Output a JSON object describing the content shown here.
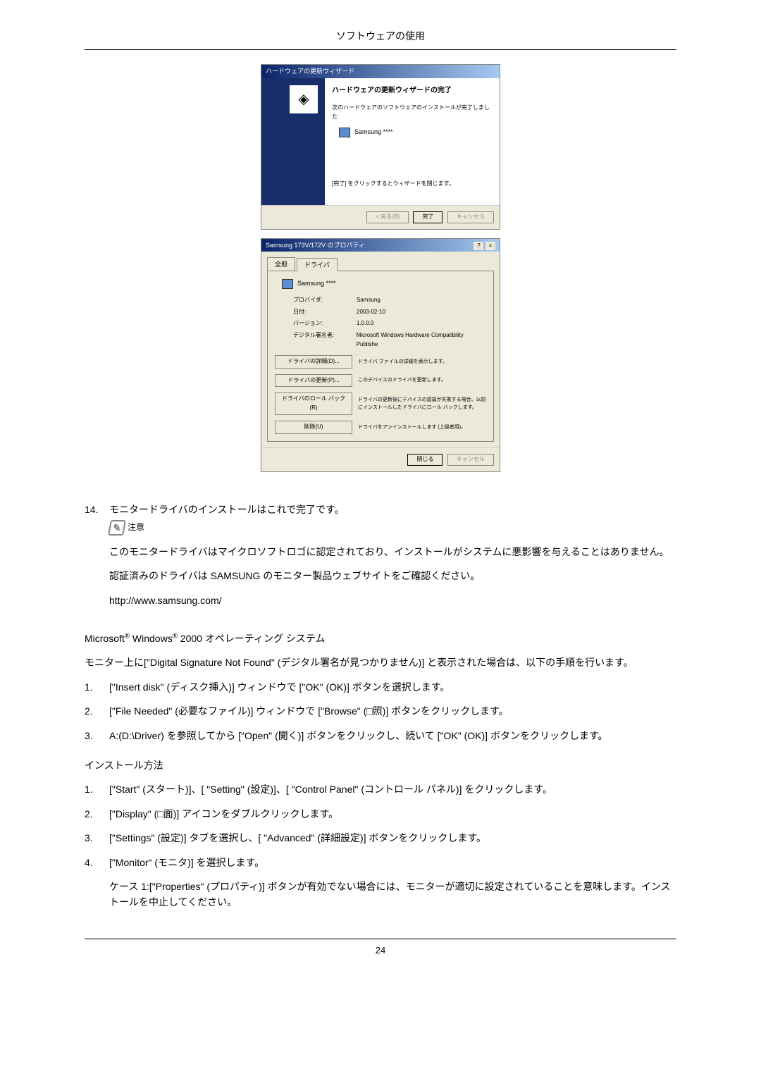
{
  "header": {
    "title": "ソフトウェアの使用"
  },
  "wizard": {
    "titlebar": "ハードウェアの更新ウィザード",
    "heading": "ハードウェアの更新ウィザードの完了",
    "subtitle": "次のハードウェアのソフトウェアのインストールが完了しました",
    "device": "Samsung ****",
    "footer_text": "[完了] をクリックするとウィザードを閉じます。",
    "btn_back": "< 戻る(B)",
    "btn_finish": "完了",
    "btn_cancel": "キャンセル"
  },
  "props": {
    "titlebar": "Samsung 173V/172V のプロパティ",
    "close_help": "?",
    "close_x": "×",
    "tab_general": "全般",
    "tab_driver": "ドライバ",
    "device_name": "Samsung ****",
    "rows": {
      "provider_label": "プロバイダ:",
      "provider_value": "Samsung",
      "date_label": "日付:",
      "date_value": "2003-02-10",
      "version_label": "バージョン:",
      "version_value": "1.0.0.0",
      "signer_label": "デジタル署名者:",
      "signer_value": "Microsoft Windows Hardware Compatibility Publishe"
    },
    "buttons": {
      "details": "ドライバの詳細(D)...",
      "details_desc": "ドライバ ファイルの詳細を表示します。",
      "update": "ドライバの更新(P)...",
      "update_desc": "このデバイスのドライバを更新します。",
      "rollback": "ドライバのロール バック(R)",
      "rollback_desc": "ドライバの更新後にデバイスの認識が失敗する場合、以前にインストールしたドライバにロール バックします。",
      "uninstall": "削除(U)",
      "uninstall_desc": "ドライバをアンインストールします (上級者用)。"
    },
    "btn_close": "閉じる",
    "btn_cancel": "キャンセル"
  },
  "step14": {
    "number": "14.",
    "text": "モニタードライバのインストールはこれで完了です。",
    "note_label": "注意",
    "note_p1": "このモニタードライバはマイクロソフトロゴに認定されており、インストールがシステムに悪影響を与えることはありません。",
    "note_p2": "認証済みのドライバは SAMSUNG のモニター製品ウェブサイトをご確認ください。",
    "note_url": "http://www.samsung.com/"
  },
  "os_heading": "Microsoft® Windows® 2000 オペレーティング システム",
  "sig_intro": "モニター上に[\"Digital Signature Not Found\" (デジタル署名が見つかりません)] と表示された場合は、以下の手順を行います。",
  "sig_steps": {
    "s1_num": "1.",
    "s1": "[\"Insert disk\" (ディスク挿入)] ウィンドウで [\"OK\" (OK)] ボタンを選択します。",
    "s2_num": "2.",
    "s2": "[\"File Needed\" (必要なファイル)] ウィンドウで [\"Browse\" (□照)] ボタンをクリックします。",
    "s3_num": "3.",
    "s3": "A:(D:\\Driver) を参照してから [\"Open\" (開く)] ボタンをクリックし、続いて [\"OK\" (OK)] ボタンをクリックします。"
  },
  "install_heading": "インストール方法",
  "install_steps": {
    "s1_num": "1.",
    "s1": "[\"Start\" (スタート)]、[ \"Setting\" (設定)]、[ \"Control Panel\" (コントロール パネル)] をクリックします。",
    "s2_num": "2.",
    "s2": "[\"Display\" (□面)] アイコンをダブルクリックします。",
    "s3_num": "3.",
    "s3": "[\"Settings\" (設定)] タブを選択し、[ \"Advanced\" (詳細設定)] ボタンをクリックします。",
    "s4_num": "4.",
    "s4": "[\"Monitor\" (モニタ)] を選択します。",
    "case1": "ケース 1:[\"Properties\" (プロパティ)] ボタンが有効でない場合には、モニターが適切に設定されていることを意味します。インストールを中止してください。"
  },
  "footer": {
    "page": "24"
  }
}
